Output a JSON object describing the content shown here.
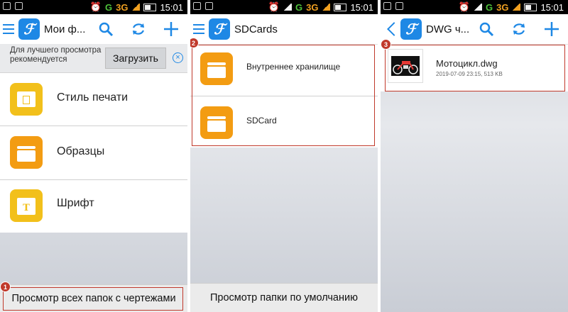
{
  "status": {
    "network": "G",
    "network_type": "3G",
    "time": "15:01"
  },
  "panel1": {
    "app_title": "Мои ф...",
    "banner": {
      "text": "Для лучшего просмотра рекомендуется",
      "button": "Загрузить"
    },
    "items": [
      {
        "label": "Стиль печати",
        "icon": "print-style-folder-icon",
        "color": "#f2c01b"
      },
      {
        "label": "Образцы",
        "icon": "folder-icon",
        "color": "#f39c12"
      },
      {
        "label": "Шрифт",
        "icon": "font-folder-icon",
        "color": "#f2c01b"
      }
    ],
    "bottom_button": "Просмотр всех папок с чертежами",
    "badge": "1"
  },
  "panel2": {
    "app_title": "SDCards",
    "items": [
      {
        "label": "Внутреннее хранилище",
        "icon": "folder-icon",
        "color": "#f39c12"
      },
      {
        "label": "SDCard",
        "icon": "folder-icon",
        "color": "#f39c12"
      }
    ],
    "bottom_button": "Просмотр папки по умолчанию",
    "badge": "2"
  },
  "panel3": {
    "app_title": "DWG ч...",
    "file": {
      "name": "Мотоцикл.dwg",
      "meta": "2019-07-09 23:15, 513 KB"
    },
    "badge": "3"
  },
  "colors": {
    "accent": "#1e88e5",
    "highlight": "#c0392b"
  }
}
